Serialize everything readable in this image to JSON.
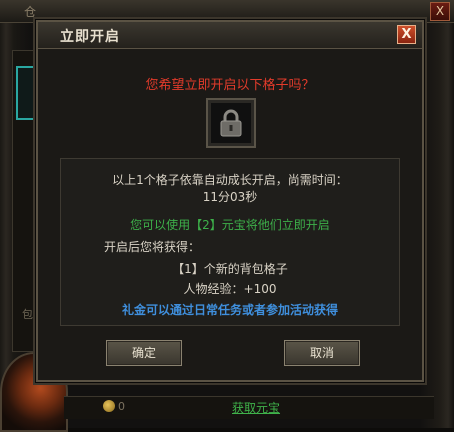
{
  "background": {
    "top_title_fragment": "仓",
    "left_label": "包",
    "close_label": "X",
    "currency_value": "0",
    "get_currency_link": "获取元宝"
  },
  "dialog": {
    "title": "立即开启",
    "close_label": "X",
    "question": "您希望立即开启以下格子吗？",
    "slot_icon": "lock-icon",
    "info": {
      "auto_open_text": "以上1个格子依靠自动成长开启，尚需时间：",
      "time_remaining": "11分03秒",
      "use_text": "您可以使用【2】元宝将他们立即开启",
      "gain_header": "开启后您将获得：",
      "reward_slot": "【1】个新的背包格子",
      "reward_exp": "人物经验：+100",
      "gift_tip": "礼金可以通过日常任务或者参加活动获得"
    },
    "buttons": {
      "confirm": "确定",
      "cancel": "取消"
    }
  },
  "colors": {
    "warning_red": "#e23b2b",
    "action_green": "#3db04a",
    "tip_blue": "#3f8fdd",
    "accent_teal": "#2aa7a1"
  }
}
